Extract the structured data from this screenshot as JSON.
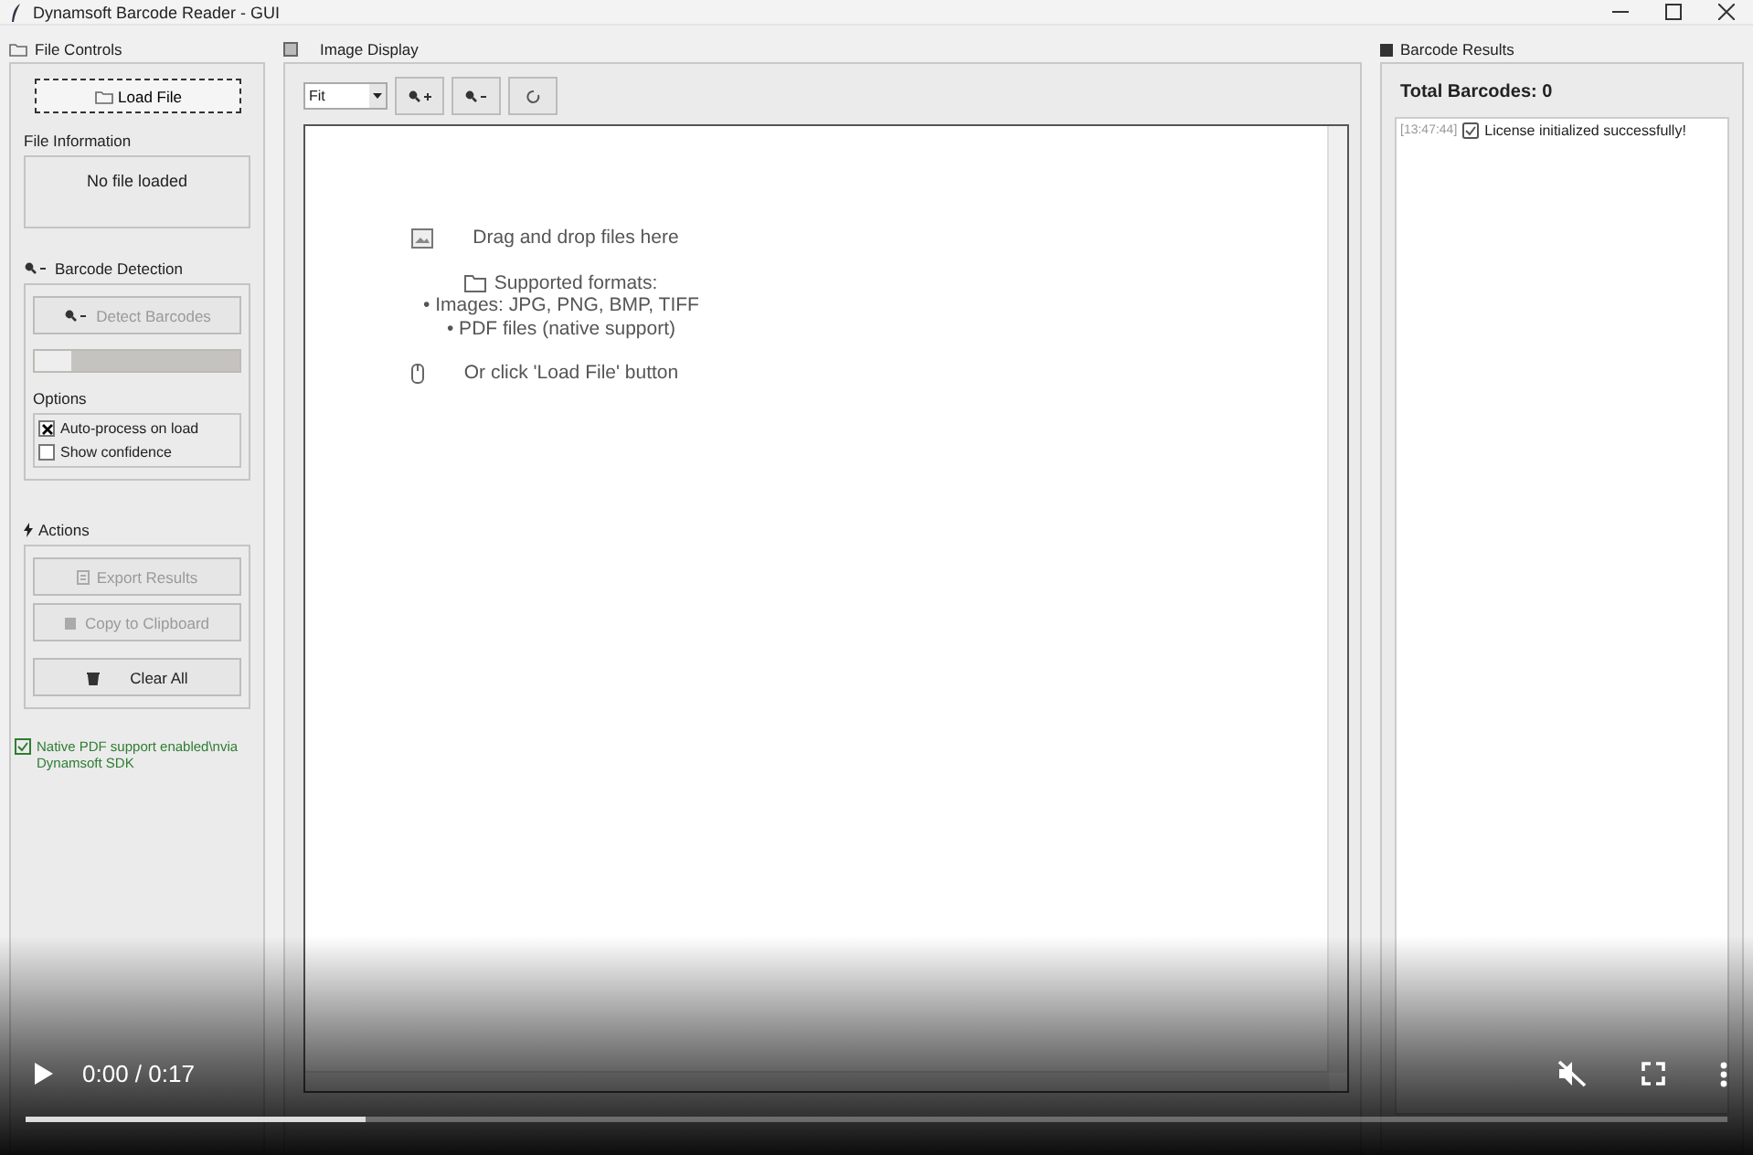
{
  "window": {
    "title": "Dynamsoft Barcode Reader - GUI"
  },
  "file_controls": {
    "title": "File Controls",
    "load_button": "Load File",
    "file_info_label": "File Information",
    "file_info": "No file loaded"
  },
  "barcode_detection": {
    "title": "Barcode Detection",
    "detect_button": {
      "label": "Detect Barcodes",
      "disabled": true
    },
    "progress": {
      "level": 0.18
    },
    "options_label": "Options",
    "options": [
      {
        "label": "Auto-process on load",
        "checked": true
      },
      {
        "label": "Show confidence",
        "checked": false
      }
    ]
  },
  "actions": {
    "title": "Actions",
    "buttons": [
      {
        "kind": "export",
        "label": "Export Results",
        "disabled": true
      },
      {
        "kind": "copy",
        "label": "Copy to Clipboard",
        "disabled": true
      },
      {
        "kind": "clear",
        "label": "Clear All",
        "disabled": false
      }
    ]
  },
  "status_note": "Native PDF support enabled\\nvia Dynamsoft SDK",
  "image_display": {
    "title": "Image Display",
    "zoom_select": "Fit",
    "tools": [
      {
        "kind": "zoom-in"
      },
      {
        "kind": "zoom-out"
      },
      {
        "kind": "reset"
      }
    ],
    "hint_lines": [
      {
        "kind": "image",
        "text": "Drag and drop files here"
      },
      {
        "kind": "folder",
        "text": "Supported formats:"
      },
      {
        "kind": "plain",
        "text": "• Images: JPG, PNG, BMP, TIFF"
      },
      {
        "kind": "plain",
        "text": "• PDF files (native support)"
      },
      {
        "kind": "mouse",
        "text": "Or click 'Load File' button"
      }
    ]
  },
  "results": {
    "title": "Barcode Results",
    "total": "Total Barcodes: 0",
    "log": [
      {
        "time": "[13:47:44]",
        "message": "License initialized successfully!"
      }
    ]
  },
  "video": {
    "time": "0:00 / 0:17",
    "muted": true,
    "level": 0.2
  }
}
